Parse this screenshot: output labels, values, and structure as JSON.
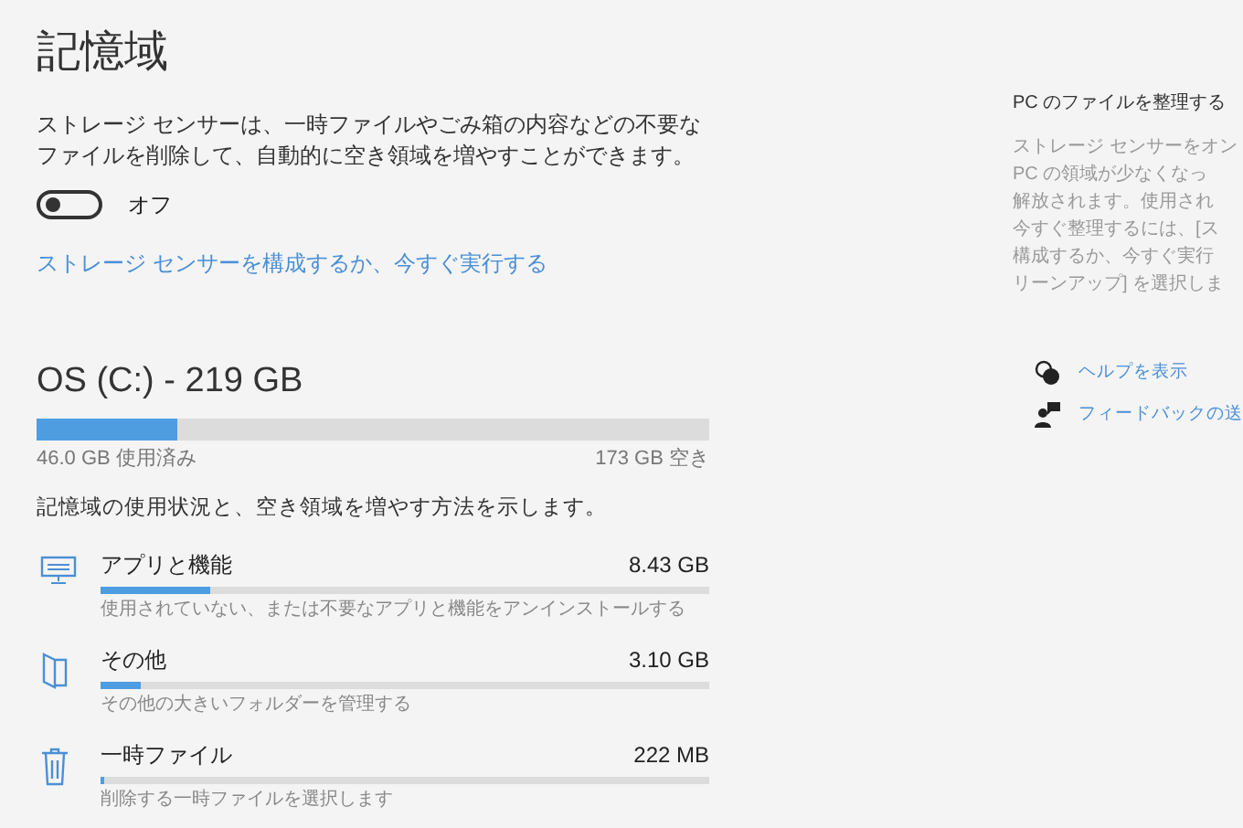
{
  "title": "記憶域",
  "sense": {
    "description": "ストレージ センサーは、一時ファイルやごみ箱の内容などの不要なファイルを削除して、自動的に空き領域を増やすことができます。",
    "on": false,
    "state_label": "オフ",
    "link": "ストレージ センサーを構成するか、今すぐ実行する"
  },
  "drive": {
    "title": "OS (C:) - 219 GB",
    "level": 0.21,
    "used": "46.0 GB 使用済み",
    "free": "173 GB 空き",
    "intro": "記憶域の使用状況と、空き領域を増やす方法を示します。"
  },
  "categories": [
    {
      "kind": "apps",
      "name": "アプリと機能",
      "size": "8.43 GB",
      "level": 0.18,
      "description": "使用されていない、または不要なアプリと機能をアンインストールする"
    },
    {
      "kind": "other",
      "name": "その他",
      "size": "3.10 GB",
      "level": 0.065,
      "description": "その他の大きいフォルダーを管理する"
    },
    {
      "kind": "temp",
      "name": "一時ファイル",
      "size": "222 MB",
      "level": 0.005,
      "description": "削除する一時ファイルを選択します"
    }
  ],
  "side": {
    "heading": "PC のファイルを整理する",
    "lines": [
      "ストレージ センサーをオン",
      "PC の領域が少なくなっ",
      "解放されます。使用され",
      "今すぐ整理するには、[ス",
      "構成するか、今すぐ実行",
      "リーンアップ] を選択しま"
    ],
    "links": [
      {
        "kind": "help",
        "label": "ヘルプを表示"
      },
      {
        "kind": "feedback",
        "label": "フィードバックの送"
      }
    ]
  }
}
